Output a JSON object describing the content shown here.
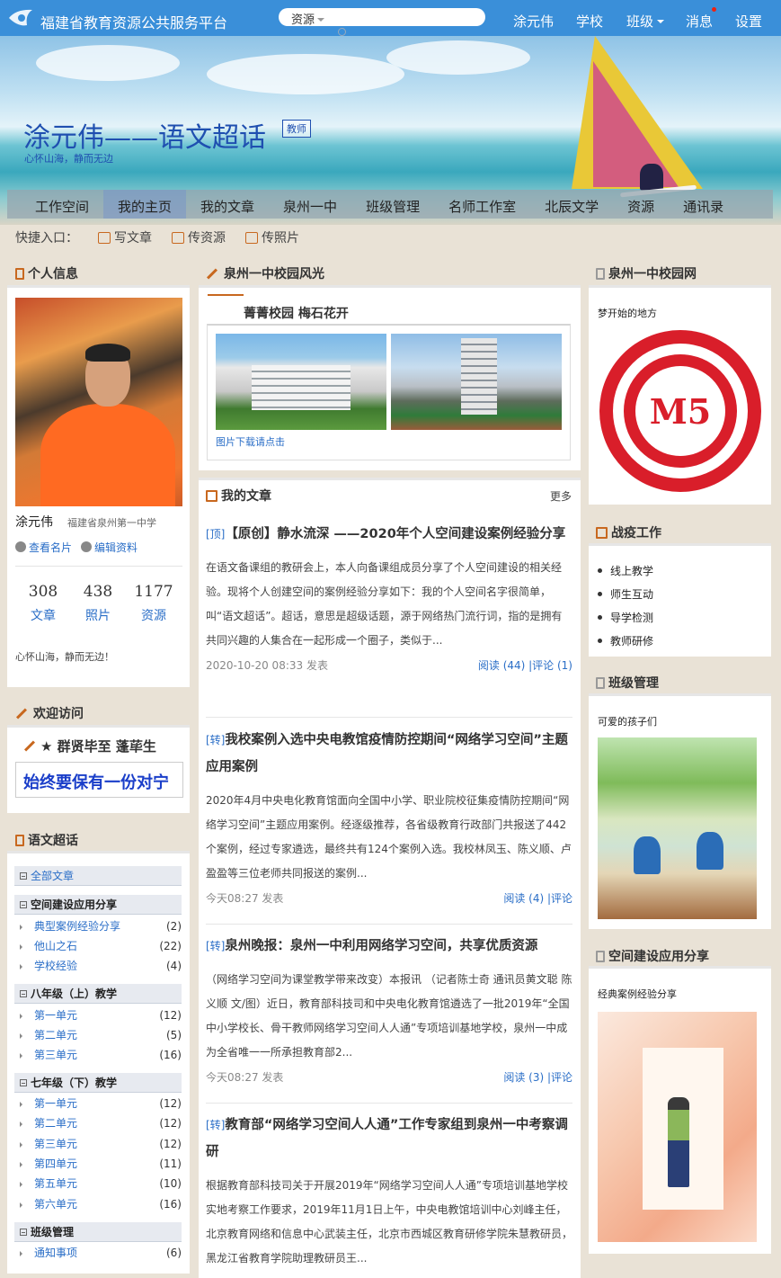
{
  "topbar": {
    "platform": "福建省教育资源公共服务平台",
    "search_type": "资源",
    "nav": [
      {
        "label": "涂元伟"
      },
      {
        "label": "学校"
      },
      {
        "label": "班级"
      },
      {
        "label": "消息"
      },
      {
        "label": "设置"
      }
    ]
  },
  "banner": {
    "title": "涂元伟——语文超话",
    "role": "教师",
    "motto": "心怀山海，静而无边"
  },
  "main_nav": [
    "工作空间",
    "我的主页",
    "我的文章",
    "泉州一中",
    "班级管理",
    "名师工作室",
    "北辰文学",
    "资源",
    "通讯录"
  ],
  "quick": {
    "label": "快捷入口：",
    "items": [
      "写文章",
      "传资源",
      "传照片"
    ]
  },
  "profile": {
    "heading": "个人信息",
    "name": "涂元伟",
    "school": "福建省泉州第一中学",
    "links": [
      "查看名片",
      "编辑资料"
    ],
    "stats": [
      {
        "n": "308",
        "l": "文章"
      },
      {
        "n": "438",
        "l": "照片"
      },
      {
        "n": "1177",
        "l": "资源"
      }
    ],
    "motto": "心怀山海，静而无边！"
  },
  "welcome": {
    "heading": "欢迎访问",
    "title": "★ 群贤毕至 蓬荜生",
    "marquee": "始终要保有一份对宁"
  },
  "tree": {
    "heading": "语文超话",
    "all": "全部文章",
    "groups": [
      {
        "name": "空间建设应用分享",
        "items": [
          {
            "name": "典型案例经验分享",
            "count": "(2)"
          },
          {
            "name": "他山之石",
            "count": "(22)"
          },
          {
            "name": "学校经验",
            "count": "(4)"
          }
        ]
      },
      {
        "name": "八年级（上）教学",
        "items": [
          {
            "name": "第一单元",
            "count": "(12)"
          },
          {
            "name": "第二单元",
            "count": "(5)"
          },
          {
            "name": "第三单元",
            "count": "(16)"
          }
        ]
      },
      {
        "name": "七年级（下）教学",
        "items": [
          {
            "name": "第一单元",
            "count": "(12)"
          },
          {
            "name": "第二单元",
            "count": "(12)"
          },
          {
            "name": "第三单元",
            "count": "(12)"
          },
          {
            "name": "第四单元",
            "count": "(11)"
          },
          {
            "name": "第五单元",
            "count": "(10)"
          },
          {
            "name": "第六单元",
            "count": "(16)"
          }
        ]
      },
      {
        "name": "班级管理",
        "items": [
          {
            "name": "通知事项",
            "count": "(6)"
          }
        ]
      }
    ]
  },
  "campus": {
    "heading": "泉州一中校园风光",
    "title": "菁菁校园 梅石花开",
    "download": "图片下载请点击"
  },
  "articles": {
    "heading": "我的文章",
    "more": "更多",
    "items": [
      {
        "tag": "[顶]",
        "title": "【原创】静水流深 ——2020年个人空间建设案例经验分享",
        "body": "在语文备课组的教研会上，本人向备课组成员分享了个人空间建设的相关经验。现将个人创建空间的案例经验分享如下：我的个人空间名字很简单，叫“语文超话”。超话，意思是超级话题，源于网络热门流行词，指的是拥有共同兴趣的人集合在一起形成一个圈子，类似于...",
        "time": "2020-10-20 08:33 发表",
        "stats": "阅读 (44) |评论 (1)"
      },
      {
        "tag": "[转]",
        "title": "我校案例入选中央电教馆疫情防控期间“网络学习空间”主题应用案例",
        "body": "2020年4月中央电化教育馆面向全国中小学、职业院校征集疫情防控期间“网络学习空间”主题应用案例。经逐级推荐，各省级教育行政部门共报送了442个案例，经过专家遴选，最终共有124个案例入选。我校林凤玉、陈义顺、卢盈盈等三位老师共同报送的案例...",
        "time": "今天08:27 发表",
        "stats": "阅读 (4) |评论"
      },
      {
        "tag": "[转]",
        "title": "泉州晚报：泉州一中利用网络学习空间，共享优质资源",
        "body": "（网络学习空间为课堂教学带来改变）本报讯 （记者陈士奇 通讯员黄文聪 陈义顺 文/图）近日，教育部科技司和中央电化教育馆遴选了一批2019年“全国中小学校长、骨干教师网络学习空间人人通”专项培训基地学校，泉州一中成为全省唯一一所承担教育部2...",
        "time": "今天08:27 发表",
        "stats": "阅读 (3) |评论"
      },
      {
        "tag": "[转]",
        "title": "教育部“网络学习空间人人通”工作专家组到泉州一中考察调研",
        "body": "根据教育部科技司关于开展2019年“网络学习空间人人通”专项培训基地学校实地考察工作要求，2019年11月1日上午，中央电教馆培训中心刘峰主任，北京教育网络和信息中心武装主任，北京市西城区教育研修学院朱慧教研员，黑龙江省教育学院助理教研员王...",
        "time": "",
        "stats": ""
      }
    ]
  },
  "right": {
    "school_heading": "泉州一中校园网",
    "school_caption": "梦开始的地方",
    "seal_text": "M5",
    "epidemic_heading": "战疫工作",
    "epidemic_items": [
      "线上教学",
      "师生互动",
      "导学检测",
      "教师研修"
    ],
    "class_heading": "班级管理",
    "class_caption": "可爱的孩子们",
    "share_heading": "空间建设应用分享",
    "share_caption": "经典案例经验分享"
  }
}
